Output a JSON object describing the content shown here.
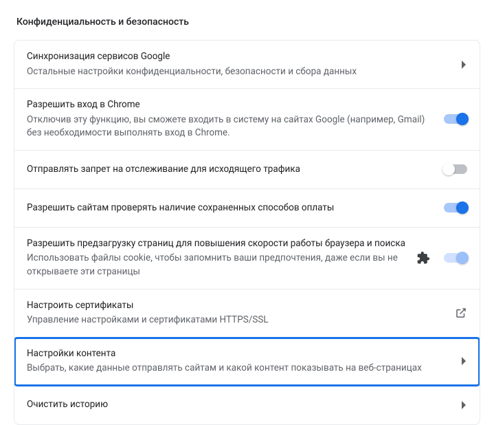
{
  "section_title": "Конфиденциальность и безопасность",
  "rows": [
    {
      "title": "Синхронизация сервисов Google",
      "desc": "Остальные настройки конфиденциальности, безопасности и сбора данных"
    },
    {
      "title": "Разрешить вход в Chrome",
      "desc": "Отключив эту функцию, вы сможете входить в систему на сайтах Google (например, Gmail) без необходимости выполнять вход в Chrome."
    },
    {
      "title": "Отправлять запрет на отслеживание для исходящего трафика"
    },
    {
      "title": "Разрешить сайтам проверять наличие сохраненных способов оплаты"
    },
    {
      "title": "Разрешить предзагрузку страниц для повышения скорости работы браузера и поиска",
      "desc": "Использовать файлы cookie, чтобы запомнить ваши предпочтения, даже если вы не открываете эти страницы"
    },
    {
      "title": "Настроить сертификаты",
      "desc": "Управление настройками и сертификатами HTTPS/SSL"
    },
    {
      "title": "Настройки контента",
      "desc": "Выбрать, какие данные отправлять сайтам и какой контент показывать на веб-страницах"
    },
    {
      "title": "Очистить историю"
    }
  ]
}
